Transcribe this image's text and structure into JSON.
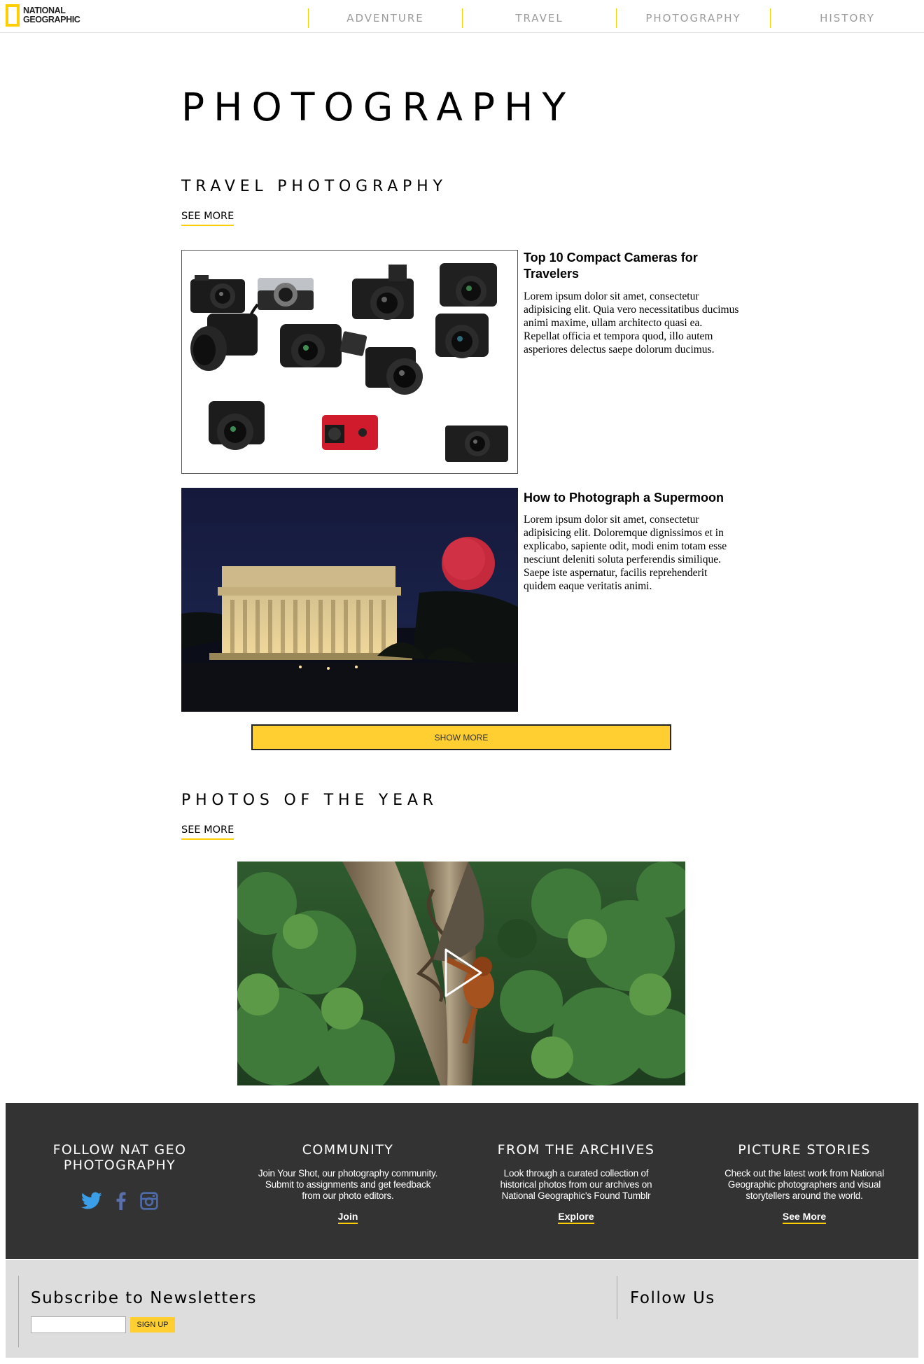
{
  "header": {
    "logo_line1": "NATIONAL",
    "logo_line2": "GEOGRAPHIC",
    "nav": [
      "ADVENTURE",
      "TRAVEL",
      "PHOTOGRAPHY",
      "HISTORY"
    ]
  },
  "page_title": "PHOTOGRAPHY",
  "travel": {
    "title": "TRAVEL PHOTOGRAPHY",
    "see_more": "SEE MORE",
    "articles": [
      {
        "title": "Top 10 Compact Cameras for Travelers",
        "body": "Lorem ipsum dolor sit amet, consectetur adipisicing elit. Quia vero necessitatibus ducimus animi maxime, ullam architecto quasi ea. Repellat officia et tempora quod, illo autem asperiores delectus saepe dolorum ducimus."
      },
      {
        "title": "How to Photograph a Supermoon",
        "body": "Lorem ipsum dolor sit amet, consectetur adipisicing elit. Doloremque dignissimos et in explicabo, sapiente odit, modi enim totam esse nesciunt deleniti soluta perferendis similique. Saepe iste aspernatur, facilis reprehenderit quidem eaque veritatis animi."
      }
    ],
    "show_more": "SHOW MORE"
  },
  "photos_of_year": {
    "title": "PHOTOS OF THE YEAR",
    "see_more": "SEE MORE"
  },
  "footer": {
    "columns": [
      {
        "title_line1": "FOLLOW NAT GEO",
        "title_line2": "PHOTOGRAPHY",
        "icons": [
          "twitter-icon",
          "facebook-icon",
          "instagram-icon"
        ]
      },
      {
        "title": "COMMUNITY",
        "text": "Join Your Shot, our photography community. Submit to assignments and get feedback from our photo editors.",
        "link": "Join"
      },
      {
        "title": "FROM THE ARCHIVES",
        "text": "Look through a curated collection of historical photos from our archives on National Geographic's Found Tumblr",
        "link": "Explore"
      },
      {
        "title": "PICTURE STORIES",
        "text": "Check out the latest work from National Geographic photographers and visual storytellers around the world.",
        "link": "See More"
      }
    ],
    "subscribe_title": "Subscribe to Newsletters",
    "sign_up": "SIGN UP",
    "follow_title": "Follow Us"
  },
  "colors": {
    "brand_yellow": "#ffce00",
    "footer_dark": "#333333",
    "footer_light": "#dddddd",
    "twitter_blue": "#3a9ee8",
    "facebook_blue": "#5b6fab",
    "instagram_blue": "#4d6aa6"
  }
}
